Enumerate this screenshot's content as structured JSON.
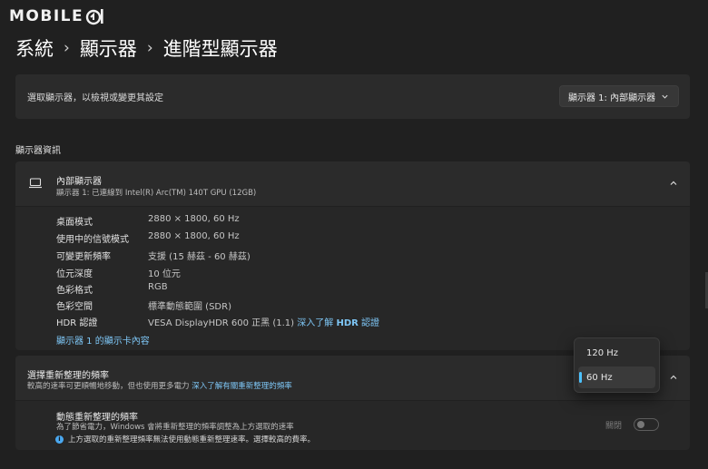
{
  "logo": {
    "text": "MOBILE"
  },
  "breadcrumb": {
    "part1": "系統",
    "part2": "顯示器",
    "part3": "進階型顯示器",
    "sep": "›"
  },
  "select_display": {
    "label": "選取顯示器，以檢視或變更其設定",
    "dropdown_value": "顯示器 1: 內部顯示器"
  },
  "section": {
    "title": "顯示器資訊"
  },
  "display_info": {
    "name": "內部顯示器",
    "subtitle": "顯示器 1: 已連線到 Intel(R) Arc(TM) 140T GPU (12GB)",
    "rows": [
      {
        "key": "桌面模式",
        "value": "2880 × 1800, 60 Hz"
      },
      {
        "key": "使用中的信號模式",
        "value": "2880 × 1800, 60 Hz"
      },
      {
        "key": "可變更新頻率",
        "value": "支援 (15 赫茲 - 60 赫茲)"
      },
      {
        "key": "位元深度",
        "value": "10 位元"
      },
      {
        "key": "色彩格式",
        "value": "RGB"
      },
      {
        "key": "色彩空間",
        "value": "標準動態範圍 (SDR)"
      },
      {
        "key": "HDR 認證",
        "value": "VESA DisplayHDR 600 正黑 (1.1)",
        "link_pre": "深入了解",
        "link_bold": "HDR",
        "link_post": "認證"
      }
    ],
    "adapter_link": "顯示器 1 的顯示卡內容"
  },
  "refresh_rate": {
    "title": "選擇重新整理的頻率",
    "desc": "較高的速率可更順暢地移動，但也使用更多電力",
    "desc_link": "深入了解有關重新整理的頻率",
    "options": [
      "120 Hz",
      "60 Hz"
    ],
    "selected": "60 Hz"
  },
  "dynamic_refresh": {
    "title": "動態重新整理的頻率",
    "desc": "為了節省電力，Windows 會將重新整理的頻率調整為上方選取的速率",
    "note": "上方選取的重新整理頻率無法使用動態重新整理速率。選擇較高的費率。",
    "toggle_label": "關閉",
    "toggle_on": false
  },
  "colors": {
    "background": "#202020",
    "card": "#2b2b2b",
    "link": "#7ec6f5",
    "accent": "#4cc2ff"
  }
}
